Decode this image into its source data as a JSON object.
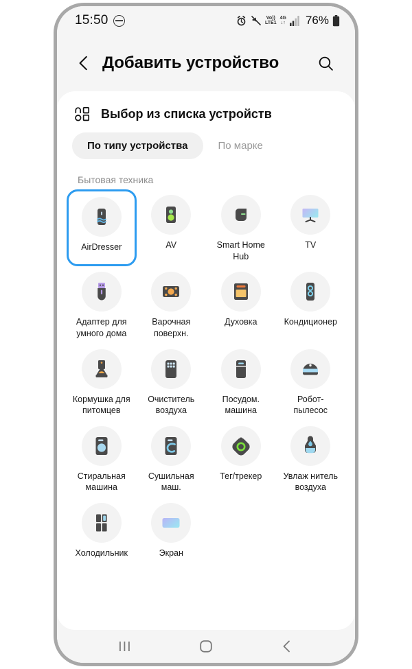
{
  "status_bar": {
    "time": "15:50",
    "dnd_icon": "do-not-disturb-icon",
    "alarm_icon": "alarm-icon",
    "mute_icon": "mute-icon",
    "volte_line1": "Vo))",
    "volte_line2": "LTE1",
    "network_line1": "4G",
    "network_line2": "↓↑",
    "signal_icon": "signal-bars-icon",
    "battery_percent": "76%",
    "battery_icon": "battery-icon"
  },
  "header": {
    "back_icon": "back-chevron-icon",
    "title": "Добавить устройство",
    "search_icon": "search-icon"
  },
  "section": {
    "grid_icon": "device-list-grid-icon",
    "title": "Выбор из списка устройств"
  },
  "tabs": [
    {
      "label": "По типу устройства",
      "active": true
    },
    {
      "label": "По марке",
      "active": false
    }
  ],
  "category": {
    "label": "Бытовая техника"
  },
  "devices": [
    {
      "label": "AirDresser",
      "icon": "airdresser-icon",
      "selected": true
    },
    {
      "label": "AV",
      "icon": "av-speaker-icon",
      "selected": false
    },
    {
      "label": "Smart Home Hub",
      "icon": "smart-home-hub-icon",
      "selected": false
    },
    {
      "label": "TV",
      "icon": "tv-icon",
      "selected": false
    },
    {
      "label": "Адаптер для умного дома",
      "icon": "smart-home-adapter-icon",
      "selected": false
    },
    {
      "label": "Варочная поверхн.",
      "icon": "cooktop-icon",
      "selected": false
    },
    {
      "label": "Духовка",
      "icon": "oven-icon",
      "selected": false
    },
    {
      "label": "Кондиционер",
      "icon": "air-conditioner-icon",
      "selected": false
    },
    {
      "label": "Кормушка для питомцев",
      "icon": "pet-feeder-icon",
      "selected": false
    },
    {
      "label": "Очиститель воздуха",
      "icon": "air-purifier-icon",
      "selected": false
    },
    {
      "label": "Посудом. машина",
      "icon": "dishwasher-icon",
      "selected": false
    },
    {
      "label": "Робот-пылесос",
      "icon": "robot-vacuum-icon",
      "selected": false
    },
    {
      "label": "Стиральная машина",
      "icon": "washing-machine-icon",
      "selected": false
    },
    {
      "label": "Сушильная маш.",
      "icon": "dryer-icon",
      "selected": false
    },
    {
      "label": "Тег/трекер",
      "icon": "tag-tracker-icon",
      "selected": false
    },
    {
      "label": "Увлаж нитель воздуха",
      "icon": "humidifier-icon",
      "selected": false
    },
    {
      "label": "Холодильник",
      "icon": "refrigerator-icon",
      "selected": false
    },
    {
      "label": "Экран",
      "icon": "display-screen-icon",
      "selected": false
    }
  ],
  "nav_bar": {
    "recents_icon": "recents-icon",
    "home_icon": "home-icon",
    "back_icon": "back-icon"
  },
  "colors": {
    "accent_blue": "#2d9cf0",
    "icon_dark": "#4a4a4a",
    "bubble_bg": "#f3f3f3",
    "tab_active_bg": "#f0f0f0",
    "screen_bg": "#f5f5f5"
  }
}
